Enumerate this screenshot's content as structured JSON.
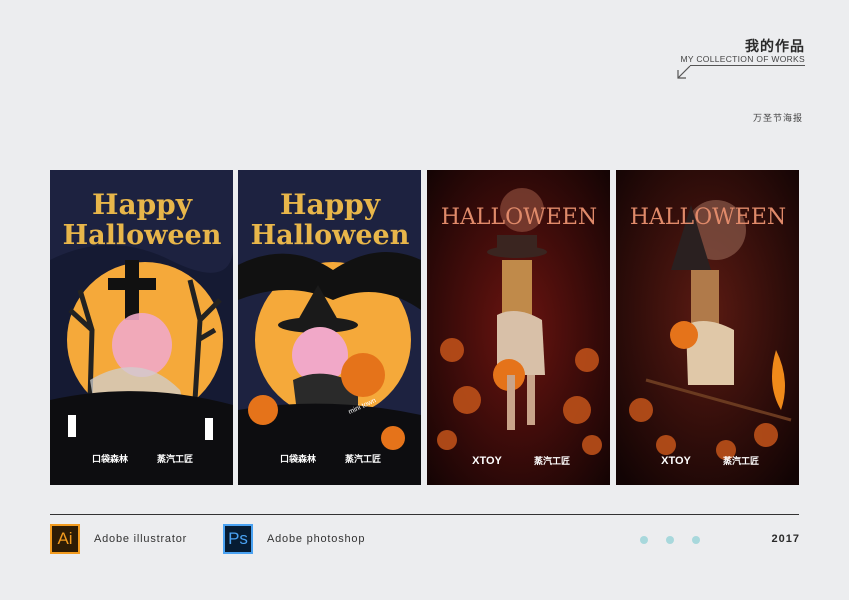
{
  "header": {
    "title": "我的作品",
    "subtitle": "MY COLLECTION OF WORKS",
    "category": "万圣节海报"
  },
  "posters": [
    {
      "line1": "Happy",
      "line2": "Halloween",
      "logo_left": "口袋森林",
      "logo_right": "蒸汽工匠"
    },
    {
      "line1": "Happy",
      "line2": "Halloween",
      "logo_left": "口袋森林",
      "logo_right": "蒸汽工匠",
      "pumpkin_label": "mini town"
    },
    {
      "title": "HALLOWEEN",
      "logo_left": "XTOY",
      "logo_right": "蒸汽工匠"
    },
    {
      "title": "HALLOWEEN",
      "logo_left": "XTOY",
      "logo_right": "蒸汽工匠"
    }
  ],
  "footer": {
    "tools": [
      {
        "icon": "Ai",
        "name": "Adobe illustrator"
      },
      {
        "icon": "Ps",
        "name": "Adobe photoshop"
      }
    ],
    "year": "2017"
  },
  "colors": {
    "background": "#ecedef",
    "ai_accent": "#f29b1f",
    "ps_accent": "#4aa2f2",
    "dots": "#a8d8dc",
    "title_gold": "#e8b64a"
  }
}
